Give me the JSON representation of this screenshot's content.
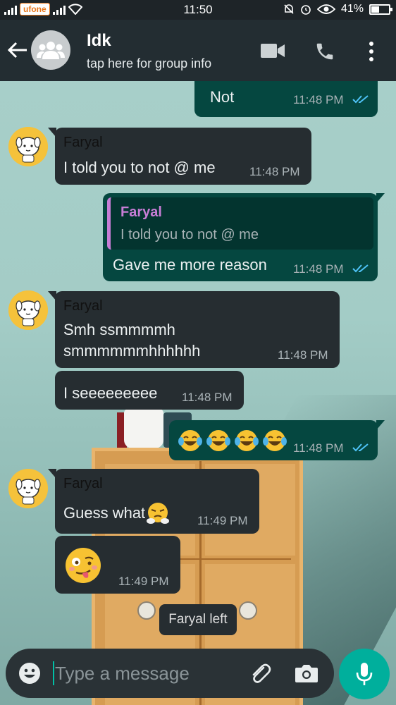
{
  "status_bar": {
    "carrier": "ufone",
    "time": "11:50",
    "battery": "41%"
  },
  "header": {
    "title": "Idk",
    "subtitle": "tap here for group info"
  },
  "messages": [
    {
      "text": "Not",
      "time": "11:48 PM"
    },
    {
      "sender": "Faryal",
      "text": "I told you to not @ me",
      "time": "11:48 PM"
    },
    {
      "quote_sender": "Faryal",
      "quote_text": "I told you to not @ me",
      "text": "Gave me more reason",
      "time": "11:48 PM"
    },
    {
      "sender": "Faryal",
      "text_line1": "Smh ssmmmmh",
      "text_line2": "smmmmmmhhhhhh",
      "time": "11:48 PM"
    },
    {
      "text": "I seeeeeeeee",
      "time": "11:48 PM"
    },
    {
      "time": "11:48 PM"
    },
    {
      "sender": "Faryal",
      "text": "Guess what",
      "time": "11:49 PM"
    },
    {
      "time": "11:49 PM"
    }
  ],
  "system_message": "Faryal left",
  "input": {
    "placeholder": "Type a message"
  },
  "colors": {
    "header_bg": "#232d32",
    "incoming_bubble": "#262d31",
    "outgoing_bubble": "#054740",
    "accent": "#00af9c",
    "quote_name": "#c77dd6",
    "read_ticks": "#4fc3f7"
  },
  "icons": [
    "back-arrow-icon",
    "group-icon",
    "video-call-icon",
    "phone-icon",
    "more-vert-icon",
    "emoji-icon",
    "attach-icon",
    "camera-icon",
    "mic-icon",
    "double-check-icon"
  ]
}
